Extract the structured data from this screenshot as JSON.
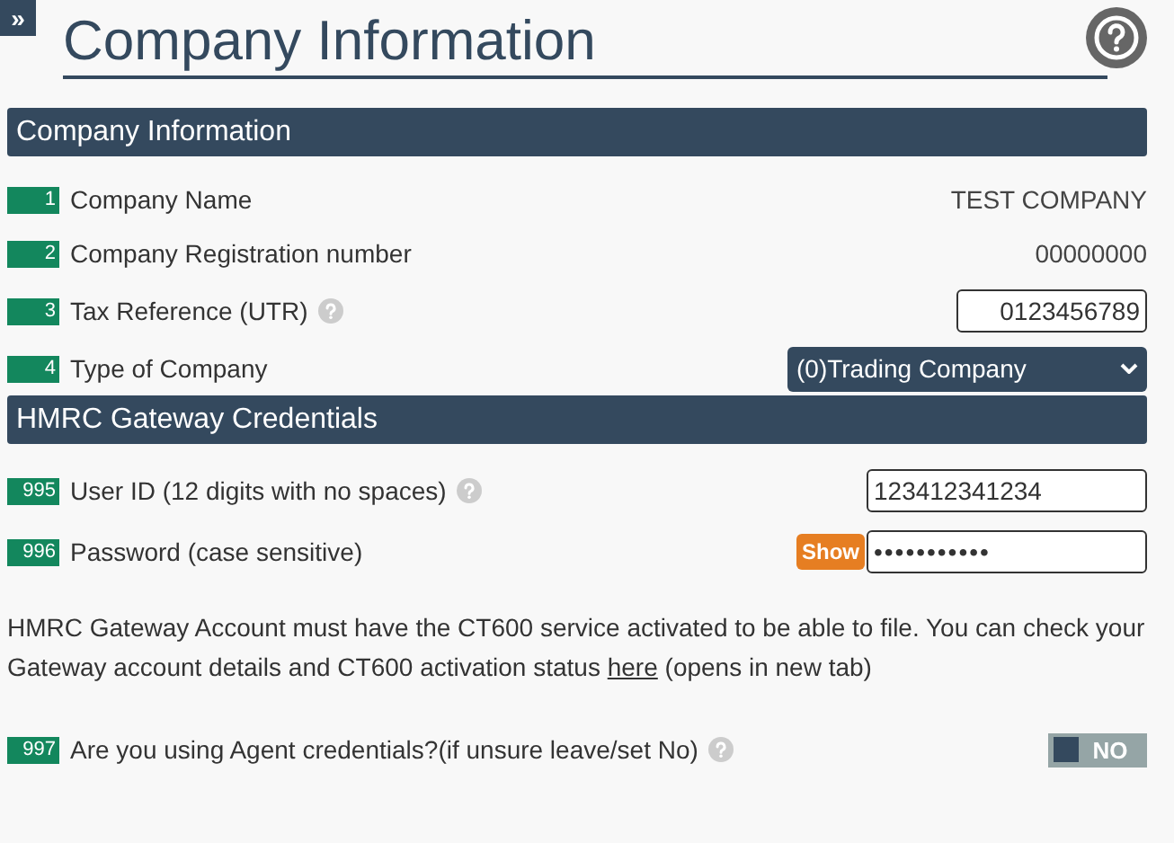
{
  "sidebar_toggle": "»",
  "title": "Company Information",
  "sections": [
    {
      "heading": "Company Information",
      "rows": [
        {
          "number": "1",
          "label": "Company Name",
          "help": false,
          "kind": "text",
          "value": "TEST COMPANY"
        },
        {
          "number": "2",
          "label": "Company Registration number",
          "help": false,
          "kind": "text",
          "value": "00000000"
        },
        {
          "number": "3",
          "label": "Tax Reference (UTR)",
          "help": true,
          "kind": "input",
          "value": "0123456789"
        },
        {
          "number": "4",
          "label": "Type of Company",
          "help": false,
          "kind": "select",
          "value": "(0)Trading Company"
        }
      ]
    },
    {
      "heading": "HMRC Gateway Credentials",
      "rows": [
        {
          "number": "995",
          "label": "User ID (12 digits with no spaces)",
          "help": true,
          "kind": "input",
          "value": "123412341234"
        },
        {
          "number": "996",
          "label": "Password (case sensitive)",
          "help": false,
          "kind": "password",
          "value": "•••••••••••",
          "show_button": "Show"
        }
      ],
      "note": {
        "before": "HMRC Gateway Account must have the CT600 service activated to be able to file. You can check your Gateway account details and CT600 activation status ",
        "link": "here",
        "after": " (opens in new tab)"
      },
      "rows_after": [
        {
          "number": "997",
          "label": "Are you using Agent credentials?(if unsure leave/set No)",
          "help": true,
          "kind": "toggle",
          "on": false,
          "state_label": "NO"
        }
      ]
    }
  ]
}
